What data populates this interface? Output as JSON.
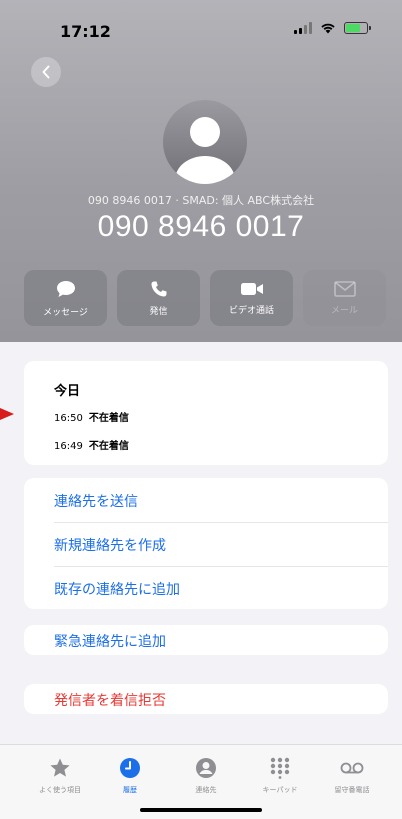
{
  "status": {
    "time": "17:12"
  },
  "contact": {
    "subtitle": "090 8946 0017 · SMAD: 個人 ABC株式会社",
    "number": "090 8946 0017"
  },
  "actions": [
    {
      "label": "メッセージ",
      "icon": "message-icon"
    },
    {
      "label": "発信",
      "icon": "phone-icon"
    },
    {
      "label": "ビデオ通話",
      "icon": "video-icon"
    },
    {
      "label": "メール",
      "icon": "mail-icon"
    }
  ],
  "history": {
    "day": "今日",
    "records": [
      {
        "time": "16:50",
        "status": "不在着信"
      },
      {
        "time": "16:49",
        "status": "不在着信"
      }
    ]
  },
  "options": {
    "send_contact": "連絡先を送信",
    "create_contact": "新規連絡先を作成",
    "add_existing": "既存の連絡先に追加",
    "add_emergency": "緊急連絡先に追加",
    "block_caller": "発信者を着信拒否"
  },
  "tabs": [
    {
      "label": "よく使う項目",
      "icon": "star-icon"
    },
    {
      "label": "履歴",
      "icon": "clock-icon"
    },
    {
      "label": "連絡先",
      "icon": "person-circle-icon"
    },
    {
      "label": "キーパッド",
      "icon": "keypad-icon"
    },
    {
      "label": "留守番電話",
      "icon": "voicemail-icon"
    }
  ],
  "colors": {
    "accent": "#1c6fe8",
    "destructive": "#e53935",
    "annotation_arrow": "#d81b1b"
  }
}
